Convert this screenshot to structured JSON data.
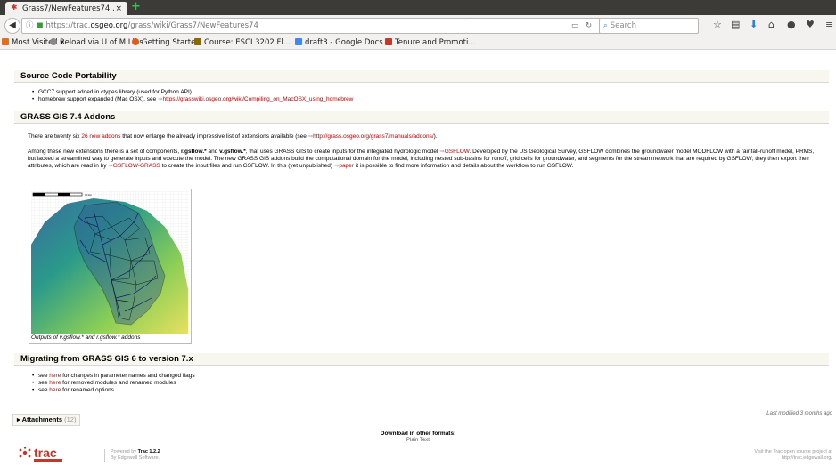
{
  "browser": {
    "tab_title": "Grass7/NewFeatures74 …",
    "url_prefix": "https://trac.",
    "url_domain": "osgeo.org",
    "url_path": "/grass/wiki/Grass7/NewFeatures74",
    "search_placeholder": "Search",
    "bookmarks": [
      {
        "label": "Most Visited ▾",
        "color": "#e07020"
      },
      {
        "label": "Reload via U of M Libs",
        "color": "#888888"
      },
      {
        "label": "Getting Started",
        "color": "#e05a1a"
      },
      {
        "label": "Course: ESCI 3202 Fl...",
        "color": "#8a6a00"
      },
      {
        "label": "draft3 - Google Docs",
        "color": "#4285f4"
      },
      {
        "label": "Tenure and Promoti...",
        "color": "#c0392b"
      }
    ]
  },
  "sections": {
    "portability": {
      "heading": "Source Code Portability",
      "bullet1": "GCC7 support added in ctypes library (used for Python API)",
      "bullet2_text": "homebrew support expanded (Mac OSX), see ",
      "bullet2_link": "https://grasswiki.osgeo.org/wiki/Compiling_on_MacOSX_using_homebrew"
    },
    "addons": {
      "heading": "GRASS GIS 7.4 Addons",
      "p1_a": "There are twenty six ",
      "p1_link": "26 new addons",
      "p1_b": " that now enlarge the already impressive list of extensions available (see ",
      "p1_url": "http://grass.osgeo.org/grass7/manuals/addons/",
      "p1_c": ").",
      "p2_a": "Among these new extensions there is a set of components, ",
      "p2_b1": "r.gsflow.*",
      "p2_b2": " and ",
      "p2_b3": "v.gsflow.*",
      "p2_c": ", that uses GRASS GIS to create inputs for the integrated hydrologic model ",
      "p2_link1": "GSFLOW",
      "p2_d": ". Developed by the US Geological Survey, GSFLOW combines the groundwater model MODFLOW with a rainfall-runoff model, PRMS, but lacked a streamlined way to generate inputs and execute the model. The new GRASS GIS addons build the computational domain for the model, including nested sub-basins for runoff, grid cells for groundwater, and segments for the stream network that are required by GSFLOW; they then export their attributes, which are read in by ",
      "p2_link2": "GSFLOW-GRASS",
      "p2_e": " to create the input files and run GSFLOW. In this (yet unpublished) ",
      "p2_link3": "paper",
      "p2_f": " it is possible to find more information and details about the workflow to run GSFLOW.",
      "caption": "Outputs of v.gsflow.* and r.gsflow.* addons",
      "scale_label": "30 km"
    },
    "migrating": {
      "heading": "Migrating from GRASS GIS 6 to version 7.x",
      "items": [
        {
          "pre": "see ",
          "link": "here",
          "post": " for changes in parameter names and changed flags"
        },
        {
          "pre": "see ",
          "link": "here",
          "post": " for removed modules and renamed modules"
        },
        {
          "pre": "see ",
          "link": "here",
          "post": " for renamed options"
        }
      ]
    }
  },
  "footer": {
    "attachments_label": "Attachments",
    "attachments_count": "(12)",
    "last_modified": "Last modified 3 months ago",
    "download_heading": "Download in other formats:",
    "download_format": "Plain Text",
    "powered_pre": "Powered by ",
    "powered_name": "Trac 1.2.2",
    "powered_by": "By Edgewall Software.",
    "visit_line1": "Visit the Trac open source project at",
    "visit_line2": "http://trac.edgewall.org/",
    "logo_text": "trac"
  }
}
